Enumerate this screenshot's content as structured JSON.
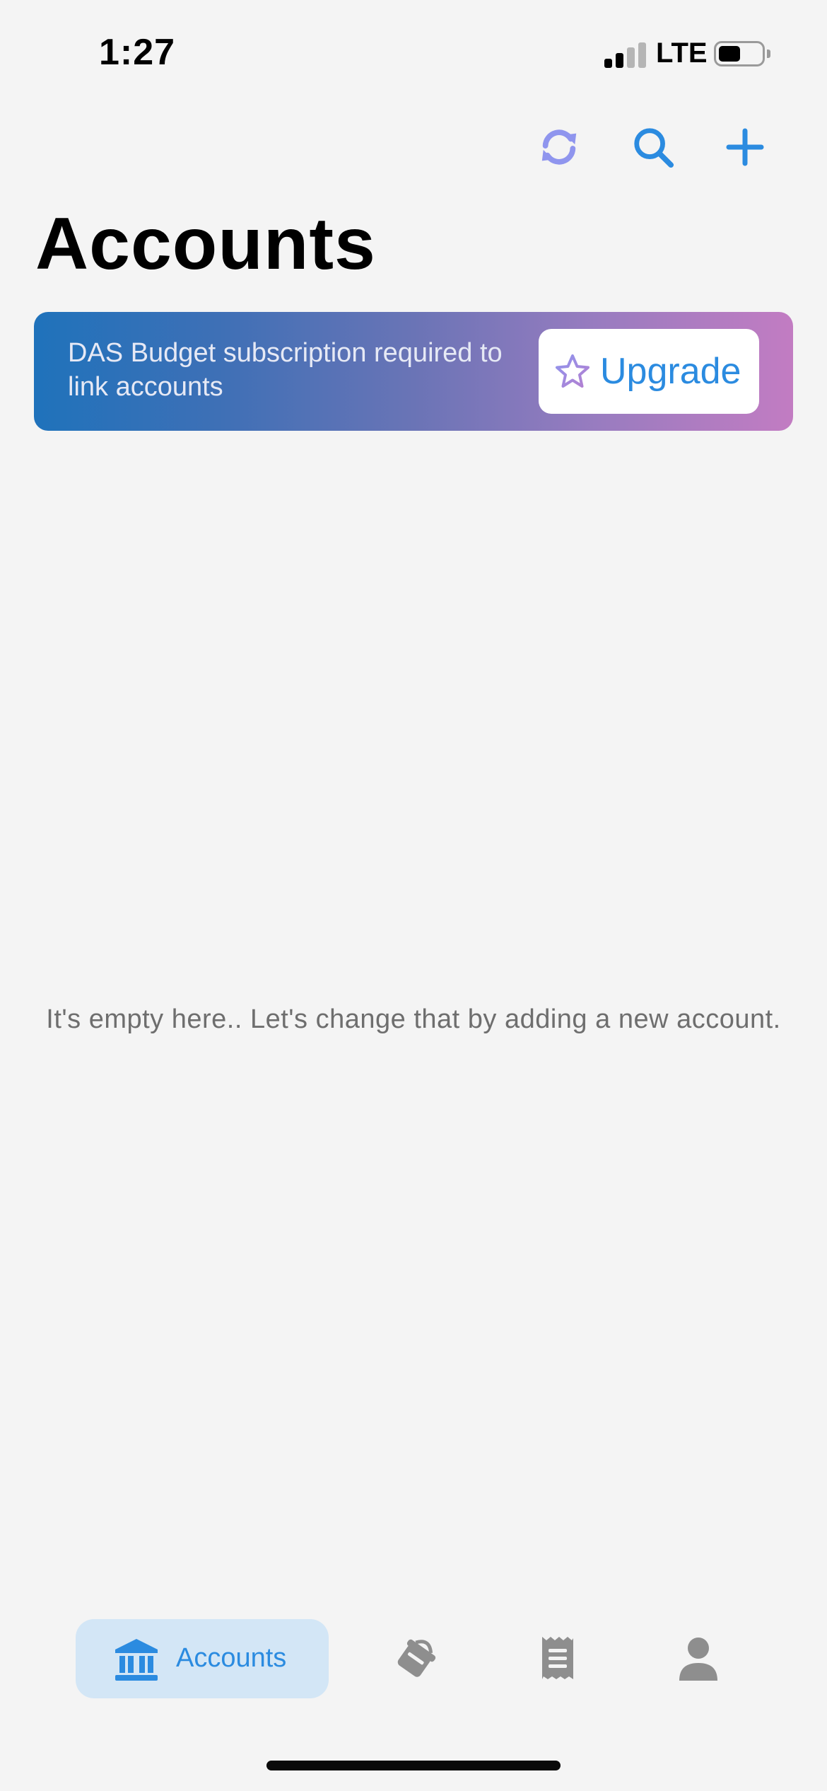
{
  "status_bar": {
    "time": "1:27",
    "network": "LTE"
  },
  "header": {
    "title": "Accounts",
    "actions": [
      {
        "name": "refresh",
        "icon": "refresh-icon",
        "color": "#8f95ee"
      },
      {
        "name": "search",
        "icon": "search-icon",
        "color": "#2b8be0"
      },
      {
        "name": "add",
        "icon": "plus-icon",
        "color": "#2b8be0"
      }
    ]
  },
  "promo": {
    "message": "DAS Budget subscription required to link accounts",
    "button_label": "Upgrade",
    "button_icon": "star-icon"
  },
  "empty_state": {
    "message": "It's empty here.. Let's change that by adding a new account."
  },
  "tab_bar": {
    "active": "accounts",
    "tabs": [
      {
        "name": "accounts",
        "label": "Accounts",
        "icon": "bank-icon"
      },
      {
        "name": "budget",
        "label": "",
        "icon": "paint-bucket-icon"
      },
      {
        "name": "transactions",
        "label": "",
        "icon": "receipt-icon"
      },
      {
        "name": "profile",
        "label": "",
        "icon": "person-icon"
      }
    ]
  },
  "colors": {
    "accent": "#2b8be0",
    "refresh_icon": "#8f95ee",
    "background": "#f4f4f4",
    "active_tab_bg": "#d3e6f6",
    "inactive_icon": "#8e8e8e",
    "promo_gradient_start": "#1f72bb",
    "promo_gradient_end": "#c27cc2"
  }
}
